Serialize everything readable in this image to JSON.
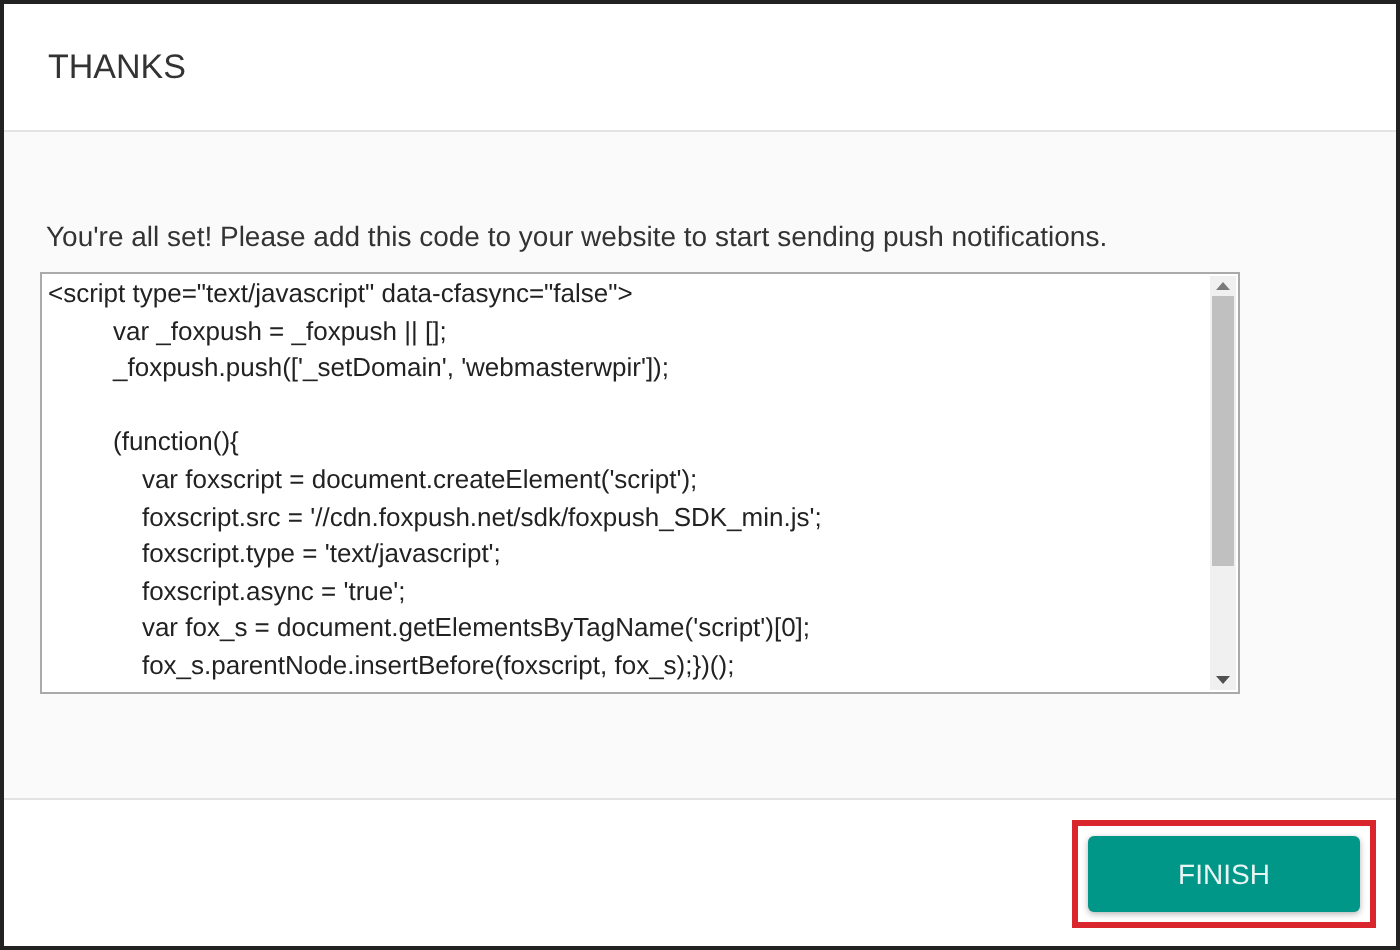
{
  "dialog": {
    "title": "THANKS"
  },
  "message": "You're all set! Please add this code to your website to start sending push notifications.",
  "code_lines": [
    {
      "text": "<script type=\"text/javascript\" data-cfasync=\"false\">",
      "gap_before": false
    },
    {
      "text": "         var _foxpush = _foxpush || [];",
      "gap_before": false
    },
    {
      "text": "         _foxpush.push(['_setDomain', 'webmasterwpir']);",
      "gap_before": false
    },
    {
      "text": "         (function(){",
      "gap_before": true
    },
    {
      "text": "             var foxscript = document.createElement('script');",
      "gap_before": false
    },
    {
      "text": "             foxscript.src = '//cdn.foxpush.net/sdk/foxpush_SDK_min.js';",
      "gap_before": false
    },
    {
      "text": "             foxscript.type = 'text/javascript';",
      "gap_before": false
    },
    {
      "text": "             foxscript.async = 'true';",
      "gap_before": false
    },
    {
      "text": "             var fox_s = document.getElementsByTagName('script')[0];",
      "gap_before": false
    },
    {
      "text": "             fox_s.parentNode.insertBefore(foxscript, fox_s);})();",
      "gap_before": false
    }
  ],
  "finish_button": {
    "label": "FINISH",
    "highlighted": true
  }
}
